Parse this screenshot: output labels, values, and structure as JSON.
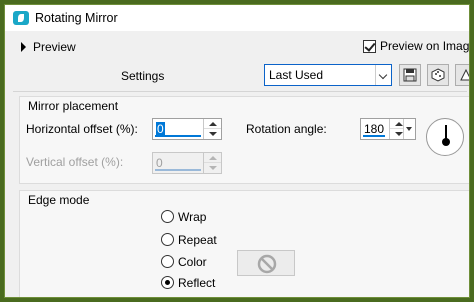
{
  "window": {
    "title": "Rotating Mirror",
    "app_icon": "psp-app-icon"
  },
  "top": {
    "preview_toggle": "Preview",
    "preview_on_image": "Preview on Image",
    "preview_on_image_checked": true
  },
  "settings": {
    "label": "Settings",
    "preset_value": "Last Used",
    "toolbar_icons": [
      "save-icon",
      "randomize-icon",
      "reset-icon"
    ]
  },
  "mirror": {
    "group_title": "Mirror placement",
    "horizontal_label": "Horizontal offset (%):",
    "horizontal_value": "0",
    "vertical_label": "Vertical offset (%):",
    "vertical_value": "0",
    "rotation_label": "Rotation angle:",
    "rotation_value": "180"
  },
  "edge": {
    "group_title": "Edge mode",
    "options": [
      "Wrap",
      "Repeat",
      "Color",
      "Reflect"
    ],
    "selected": "Reflect"
  },
  "colors": {
    "accent": "#0078d7",
    "frame": "#4a6b1f"
  }
}
